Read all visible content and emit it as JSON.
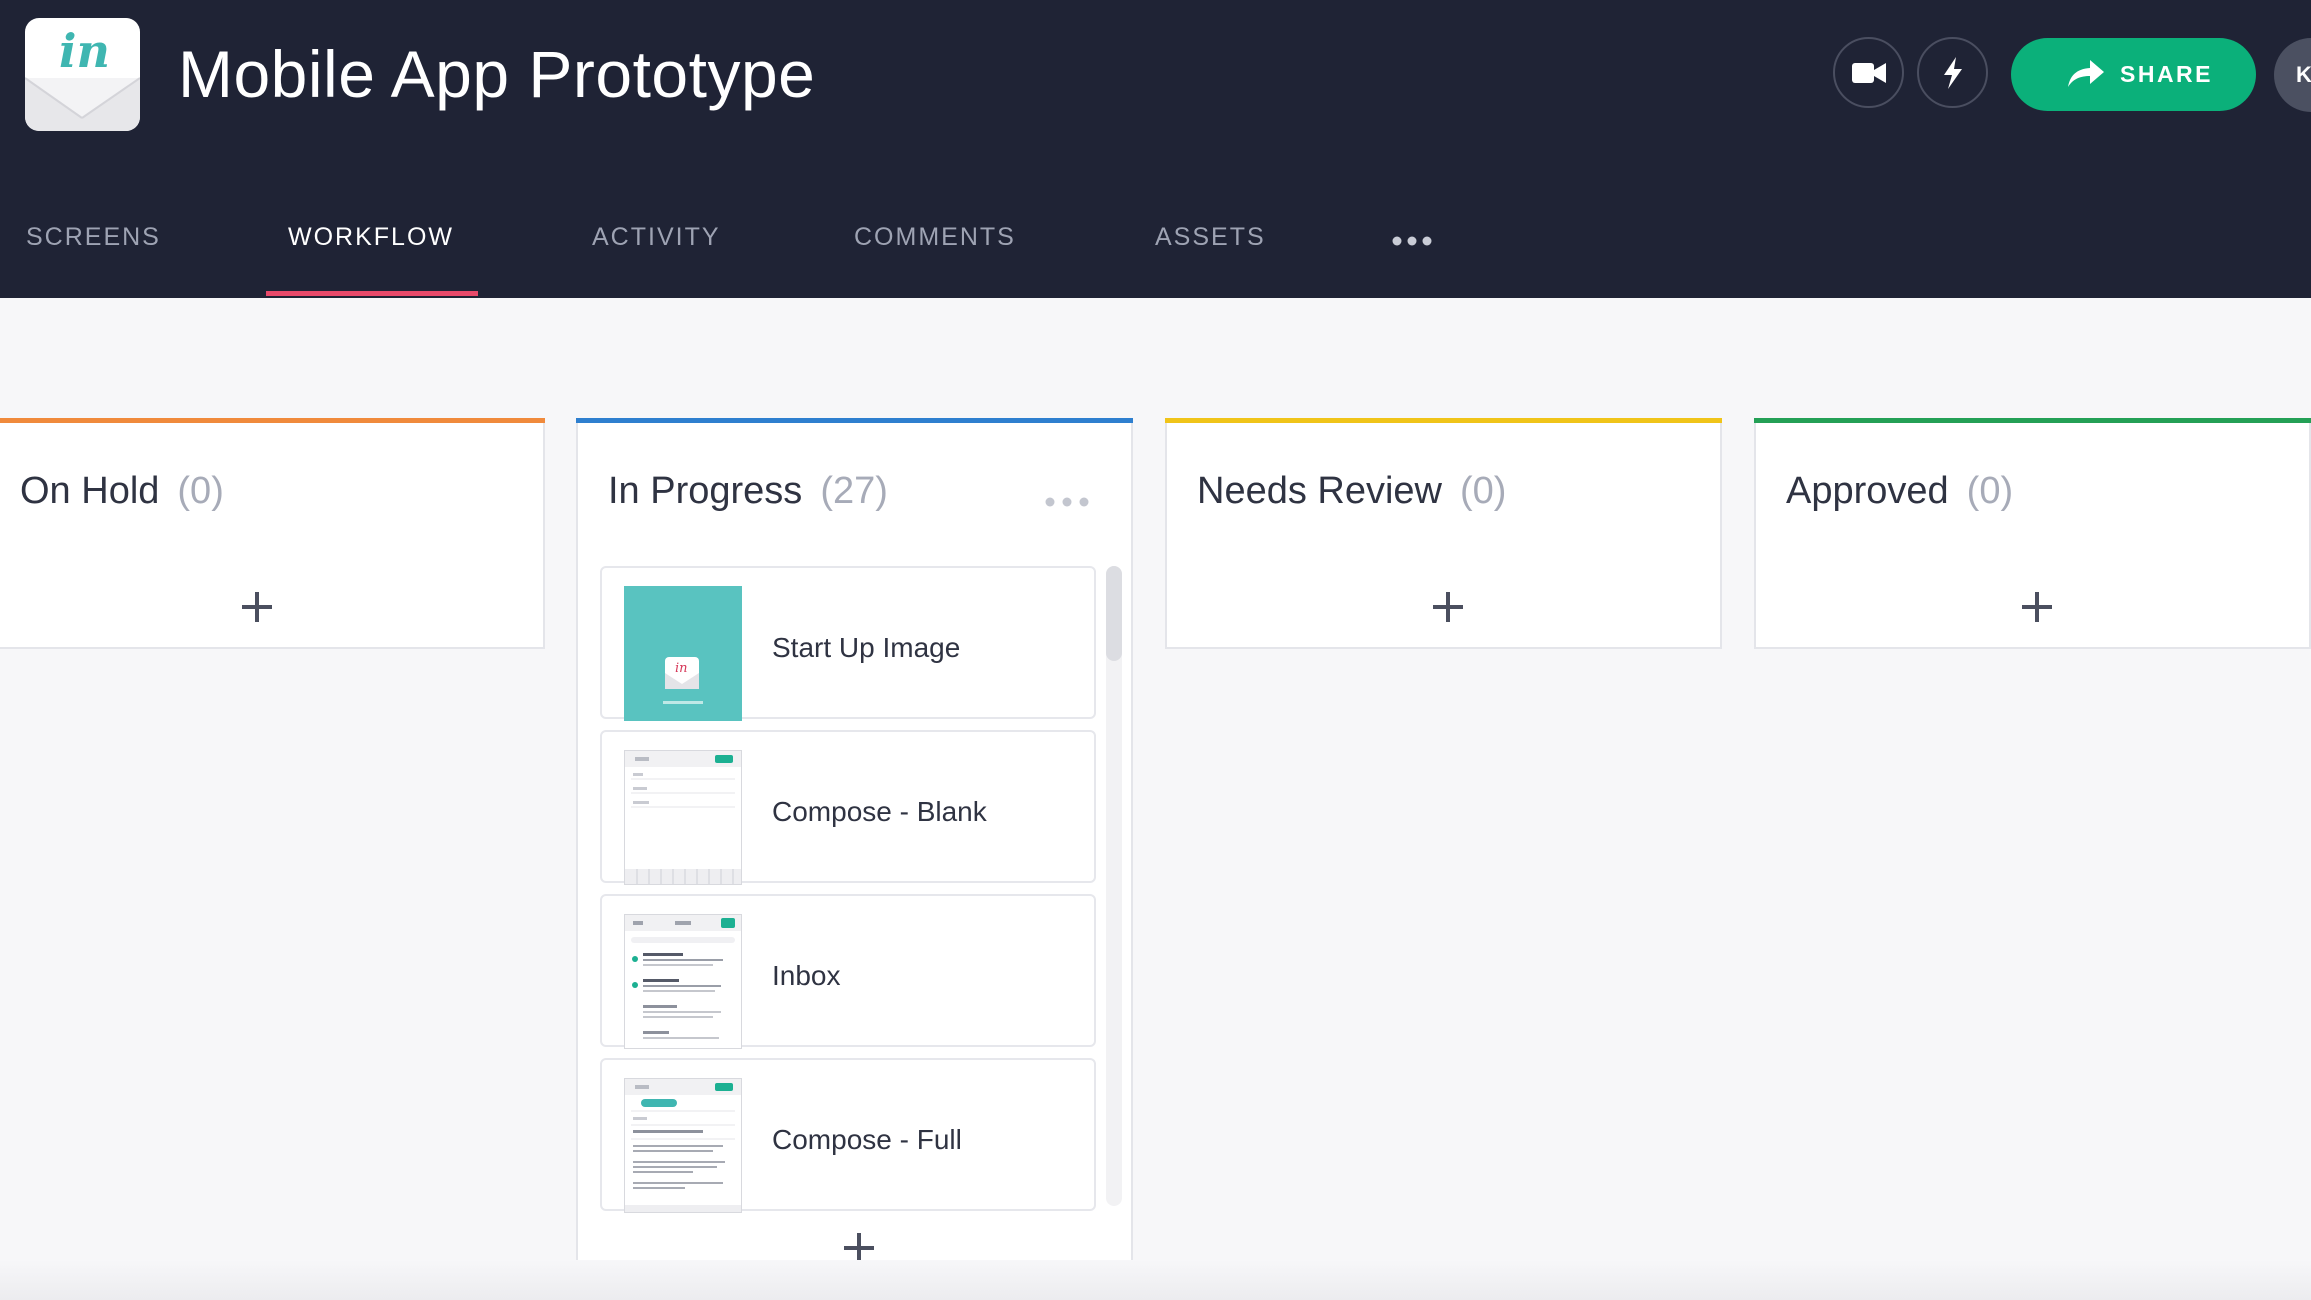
{
  "app": {
    "logo_text": "in",
    "title": "Mobile App Prototype",
    "share_label": "SHARE",
    "avatar_initial": "K"
  },
  "icons": {
    "video": "video-camera-icon",
    "lightning": "lightning-icon",
    "share": "share-arrow-icon",
    "more": "more-dots-icon",
    "add": "plus-icon"
  },
  "tabs": [
    {
      "label": "SCREENS",
      "active": false
    },
    {
      "label": "WORKFLOW",
      "active": true
    },
    {
      "label": "ACTIVITY",
      "active": false
    },
    {
      "label": "COMMENTS",
      "active": false
    },
    {
      "label": "ASSETS",
      "active": false
    }
  ],
  "columns": [
    {
      "title": "On Hold",
      "count": "(0)",
      "color": "#f08a3c"
    },
    {
      "title": "In Progress",
      "count": "(27)",
      "color": "#2e7fcf",
      "cards": [
        {
          "label": "Start Up Image"
        },
        {
          "label": "Compose - Blank"
        },
        {
          "label": "Inbox"
        },
        {
          "label": "Compose - Full"
        }
      ]
    },
    {
      "title": "Needs Review",
      "count": "(0)",
      "color": "#f0c419"
    },
    {
      "title": "Approved",
      "count": "(0)",
      "color": "#24a056"
    }
  ],
  "colors": {
    "header_bg": "#1f2335",
    "accent_green": "#0bb07a",
    "tab_underline": "#e8496a"
  }
}
